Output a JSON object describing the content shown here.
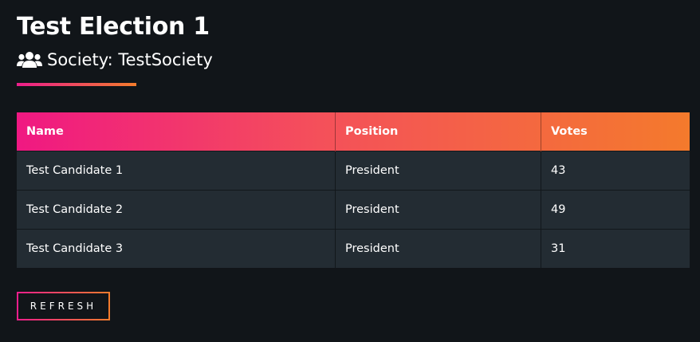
{
  "election": {
    "title": "Test Election 1",
    "society_label": "Society: TestSociety",
    "society_icon": "users-icon"
  },
  "table": {
    "columns": [
      "Name",
      "Position",
      "Votes"
    ],
    "rows": [
      {
        "name": "Test Candidate 1",
        "position": "President",
        "votes": "43"
      },
      {
        "name": "Test Candidate 2",
        "position": "President",
        "votes": "49"
      },
      {
        "name": "Test Candidate 3",
        "position": "President",
        "votes": "31"
      }
    ]
  },
  "actions": {
    "refresh_label": "REFRESH"
  },
  "colors": {
    "background": "#111519",
    "accent_start": "#ec1e8c",
    "accent_end": "#f47c2c",
    "row_background": "#232c33"
  }
}
